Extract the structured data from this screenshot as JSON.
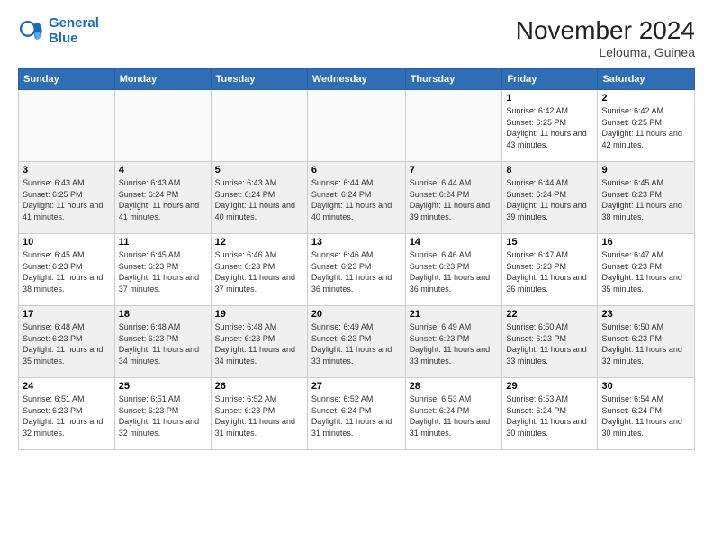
{
  "logo": {
    "line1": "General",
    "line2": "Blue"
  },
  "title": "November 2024",
  "location": "Lelouma, Guinea",
  "days_header": [
    "Sunday",
    "Monday",
    "Tuesday",
    "Wednesday",
    "Thursday",
    "Friday",
    "Saturday"
  ],
  "weeks": [
    [
      {
        "day": "",
        "info": ""
      },
      {
        "day": "",
        "info": ""
      },
      {
        "day": "",
        "info": ""
      },
      {
        "day": "",
        "info": ""
      },
      {
        "day": "",
        "info": ""
      },
      {
        "day": "1",
        "info": "Sunrise: 6:42 AM\nSunset: 6:25 PM\nDaylight: 11 hours and 43 minutes."
      },
      {
        "day": "2",
        "info": "Sunrise: 6:42 AM\nSunset: 6:25 PM\nDaylight: 11 hours and 42 minutes."
      }
    ],
    [
      {
        "day": "3",
        "info": "Sunrise: 6:43 AM\nSunset: 6:25 PM\nDaylight: 11 hours and 41 minutes."
      },
      {
        "day": "4",
        "info": "Sunrise: 6:43 AM\nSunset: 6:24 PM\nDaylight: 11 hours and 41 minutes."
      },
      {
        "day": "5",
        "info": "Sunrise: 6:43 AM\nSunset: 6:24 PM\nDaylight: 11 hours and 40 minutes."
      },
      {
        "day": "6",
        "info": "Sunrise: 6:44 AM\nSunset: 6:24 PM\nDaylight: 11 hours and 40 minutes."
      },
      {
        "day": "7",
        "info": "Sunrise: 6:44 AM\nSunset: 6:24 PM\nDaylight: 11 hours and 39 minutes."
      },
      {
        "day": "8",
        "info": "Sunrise: 6:44 AM\nSunset: 6:24 PM\nDaylight: 11 hours and 39 minutes."
      },
      {
        "day": "9",
        "info": "Sunrise: 6:45 AM\nSunset: 6:23 PM\nDaylight: 11 hours and 38 minutes."
      }
    ],
    [
      {
        "day": "10",
        "info": "Sunrise: 6:45 AM\nSunset: 6:23 PM\nDaylight: 11 hours and 38 minutes."
      },
      {
        "day": "11",
        "info": "Sunrise: 6:45 AM\nSunset: 6:23 PM\nDaylight: 11 hours and 37 minutes."
      },
      {
        "day": "12",
        "info": "Sunrise: 6:46 AM\nSunset: 6:23 PM\nDaylight: 11 hours and 37 minutes."
      },
      {
        "day": "13",
        "info": "Sunrise: 6:46 AM\nSunset: 6:23 PM\nDaylight: 11 hours and 36 minutes."
      },
      {
        "day": "14",
        "info": "Sunrise: 6:46 AM\nSunset: 6:23 PM\nDaylight: 11 hours and 36 minutes."
      },
      {
        "day": "15",
        "info": "Sunrise: 6:47 AM\nSunset: 6:23 PM\nDaylight: 11 hours and 36 minutes."
      },
      {
        "day": "16",
        "info": "Sunrise: 6:47 AM\nSunset: 6:23 PM\nDaylight: 11 hours and 35 minutes."
      }
    ],
    [
      {
        "day": "17",
        "info": "Sunrise: 6:48 AM\nSunset: 6:23 PM\nDaylight: 11 hours and 35 minutes."
      },
      {
        "day": "18",
        "info": "Sunrise: 6:48 AM\nSunset: 6:23 PM\nDaylight: 11 hours and 34 minutes."
      },
      {
        "day": "19",
        "info": "Sunrise: 6:48 AM\nSunset: 6:23 PM\nDaylight: 11 hours and 34 minutes."
      },
      {
        "day": "20",
        "info": "Sunrise: 6:49 AM\nSunset: 6:23 PM\nDaylight: 11 hours and 33 minutes."
      },
      {
        "day": "21",
        "info": "Sunrise: 6:49 AM\nSunset: 6:23 PM\nDaylight: 11 hours and 33 minutes."
      },
      {
        "day": "22",
        "info": "Sunrise: 6:50 AM\nSunset: 6:23 PM\nDaylight: 11 hours and 33 minutes."
      },
      {
        "day": "23",
        "info": "Sunrise: 6:50 AM\nSunset: 6:23 PM\nDaylight: 11 hours and 32 minutes."
      }
    ],
    [
      {
        "day": "24",
        "info": "Sunrise: 6:51 AM\nSunset: 6:23 PM\nDaylight: 11 hours and 32 minutes."
      },
      {
        "day": "25",
        "info": "Sunrise: 6:51 AM\nSunset: 6:23 PM\nDaylight: 11 hours and 32 minutes."
      },
      {
        "day": "26",
        "info": "Sunrise: 6:52 AM\nSunset: 6:23 PM\nDaylight: 11 hours and 31 minutes."
      },
      {
        "day": "27",
        "info": "Sunrise: 6:52 AM\nSunset: 6:24 PM\nDaylight: 11 hours and 31 minutes."
      },
      {
        "day": "28",
        "info": "Sunrise: 6:53 AM\nSunset: 6:24 PM\nDaylight: 11 hours and 31 minutes."
      },
      {
        "day": "29",
        "info": "Sunrise: 6:53 AM\nSunset: 6:24 PM\nDaylight: 11 hours and 30 minutes."
      },
      {
        "day": "30",
        "info": "Sunrise: 6:54 AM\nSunset: 6:24 PM\nDaylight: 11 hours and 30 minutes."
      }
    ]
  ]
}
